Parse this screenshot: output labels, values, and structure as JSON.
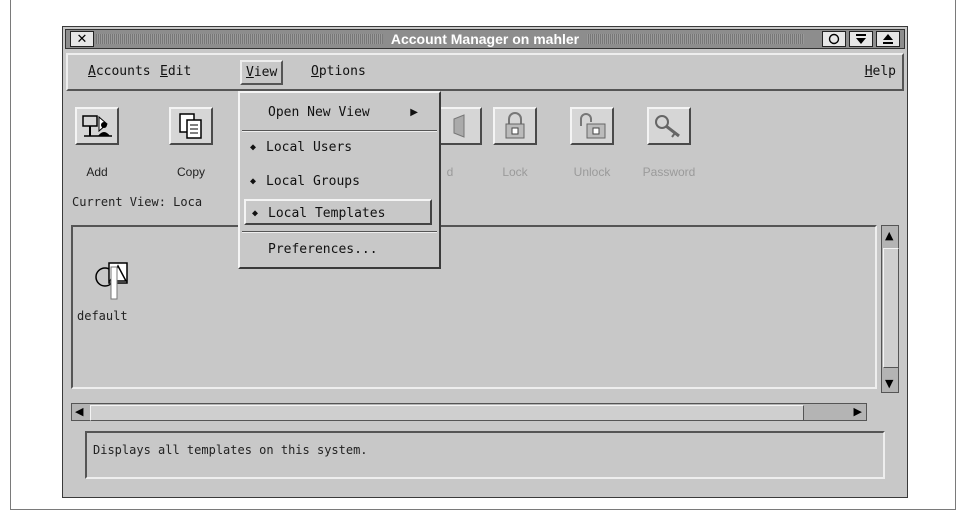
{
  "window": {
    "title": "Account Manager on mahler"
  },
  "menubar": {
    "accounts": "Accounts",
    "edit": "Edit",
    "view": "View",
    "options": "Options",
    "help": "Help"
  },
  "view_menu": {
    "open_new_view": "Open New View",
    "local_users": "Local Users",
    "local_groups": "Local Groups",
    "local_templates": "Local Templates",
    "preferences": "Preferences..."
  },
  "toolbar": {
    "add": "Add",
    "copy": "Copy",
    "remove_partial": "d",
    "lock": "Lock",
    "unlock": "Unlock",
    "password": "Password"
  },
  "current_view": "Current View: Loca",
  "items": [
    {
      "label": "default"
    }
  ],
  "status": "Displays all templates on this system."
}
